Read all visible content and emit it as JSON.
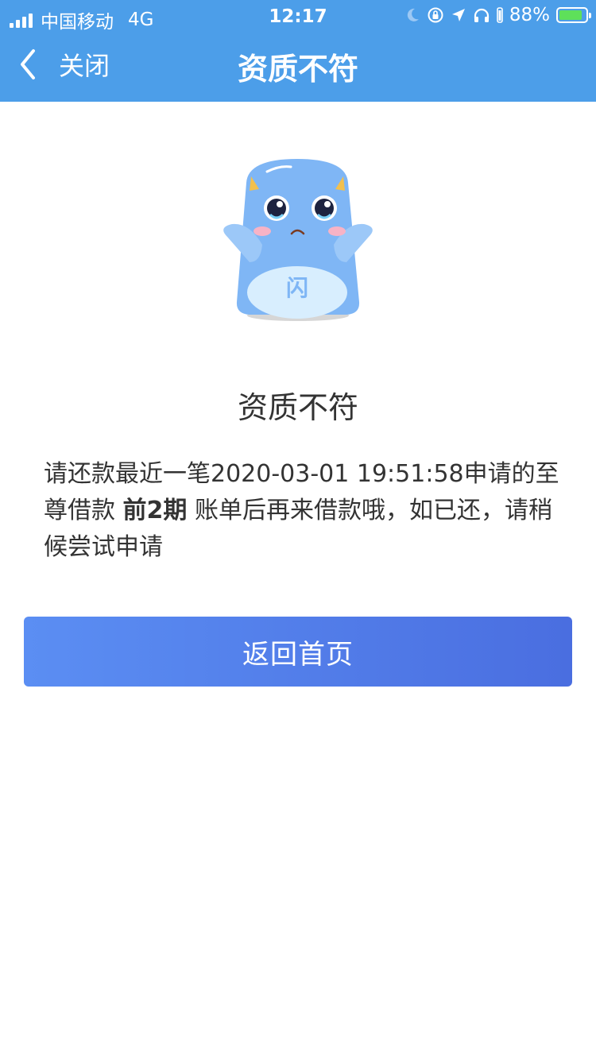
{
  "status_bar": {
    "carrier": "中国移动",
    "network": "4G",
    "time": "12:17",
    "battery_percent": "88%",
    "battery_level": 0.88,
    "icons": [
      "moon-icon",
      "orientation-lock-icon",
      "location-arrow-icon",
      "headphones-icon",
      "battery-icon"
    ]
  },
  "nav": {
    "back_label": "关闭",
    "title": "资质不符"
  },
  "mascot": {
    "glyph": "闪"
  },
  "result": {
    "title": "资质不符",
    "message_part1": "请还款最近一笔2020-03-01 19:51:58申请的至尊借款",
    "message_bold": "前2期",
    "message_part2": "账单后再来借款哦，如已还，请稍候尝试申请"
  },
  "home_button_label": "返回首页",
  "colors": {
    "header_bg": "#4c9ee9",
    "button_start": "#5b8ef3",
    "button_end": "#4a6ee0",
    "text": "#333333",
    "mascot_body": "#7fb6f5"
  }
}
